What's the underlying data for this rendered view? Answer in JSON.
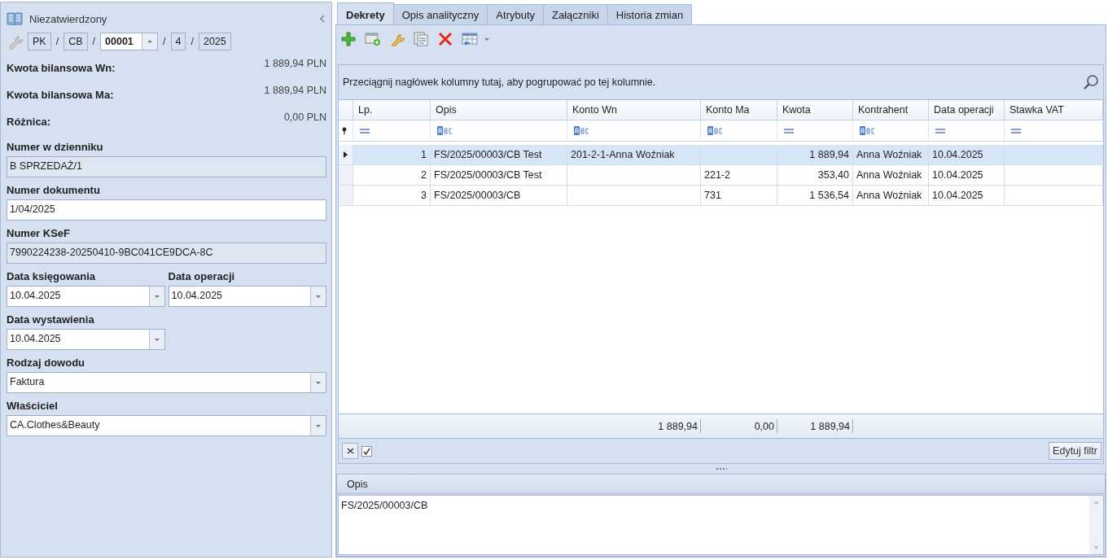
{
  "form": {
    "status": "Niezatwierdzony",
    "number_parts": [
      {
        "kind": "field",
        "text": "PK"
      },
      {
        "kind": "sep",
        "text": "/"
      },
      {
        "kind": "field",
        "text": "CB"
      },
      {
        "kind": "sep",
        "text": "/"
      },
      {
        "kind": "combo",
        "text": "00001"
      },
      {
        "kind": "sep",
        "text": "/"
      },
      {
        "kind": "field",
        "text": "4"
      },
      {
        "kind": "sep",
        "text": "/"
      },
      {
        "kind": "field",
        "text": "2025"
      }
    ],
    "summary": [
      {
        "label": "Kwota bilansowa Wn:",
        "value": "1 889,94 PLN"
      },
      {
        "label": "Kwota bilansowa Ma:",
        "value": "1 889,94 PLN"
      },
      {
        "label": "Różnica:",
        "value": "0,00 PLN"
      }
    ],
    "fields": [
      {
        "kind": "readonly",
        "label": "Numer w dzienniku",
        "value": "B SPRZEDAŻ/1"
      },
      {
        "kind": "text",
        "label": "Numer dokumentu",
        "value": "1/04/2025"
      },
      {
        "kind": "readonly",
        "label": "Numer KSeF",
        "value": "7990224238-20250410-9BC041CE9DCA-8C"
      },
      {
        "kind": "date",
        "label": "Data księgowania",
        "value": "10.04.2025"
      },
      {
        "kind": "date",
        "label": "Data operacji",
        "value": "10.04.2025"
      },
      {
        "kind": "date",
        "label": "Data wystawienia",
        "value": "10.04.2025"
      },
      {
        "kind": "combo",
        "label": "Rodzaj dowodu",
        "value": "Faktura"
      },
      {
        "kind": "combo",
        "label": "Właściciel",
        "value": "CA.Clothes&Beauty"
      }
    ]
  },
  "tabs": [
    {
      "label": "Dekrety",
      "selected": true
    },
    {
      "label": "Opis analityczny",
      "selected": false
    },
    {
      "label": "Atrybuty",
      "selected": false
    },
    {
      "label": "Załączniki",
      "selected": false
    },
    {
      "label": "Historia zmian",
      "selected": false
    }
  ],
  "grid": {
    "group_hint": "Przeciągnij nagłówek kolumny tutaj, aby pogrupować po tej kolumnie.",
    "columns": [
      {
        "label": "Lp.",
        "kind": "number",
        "filter": {
          "kind": "equals"
        }
      },
      {
        "label": "Opis",
        "kind": "text",
        "filter": {
          "kind": "text"
        }
      },
      {
        "label": "Konto Wn",
        "kind": "text",
        "filter": {
          "kind": "text"
        },
        "total": "1 889,94"
      },
      {
        "label": "Konto Ma",
        "kind": "text",
        "filter": {
          "kind": "text"
        },
        "total": "0,00"
      },
      {
        "label": "Kwota",
        "kind": "number",
        "filter": {
          "kind": "equals"
        },
        "total": "1 889,94"
      },
      {
        "label": "Kontrahent",
        "kind": "text",
        "filter": {
          "kind": "text"
        }
      },
      {
        "label": "Data operacji",
        "kind": "text",
        "filter": {
          "kind": "equals"
        }
      },
      {
        "label": "Stawka VAT",
        "kind": "text",
        "filter": {
          "kind": "equals"
        }
      }
    ],
    "rows": [
      {
        "selected": true,
        "cells": [
          "1",
          "FS/2025/00003/CB Test",
          "201-2-1-Anna Woźniak",
          null,
          "1 889,94",
          "Anna Woźniak",
          "10.04.2025",
          null
        ]
      },
      {
        "selected": false,
        "cells": [
          "2",
          "FS/2025/00003/CB Test",
          null,
          "221-2",
          "353,40",
          "Anna Woźniak",
          "10.04.2025",
          null
        ]
      },
      {
        "selected": false,
        "cells": [
          "3",
          "FS/2025/00003/CB",
          null,
          "731",
          "1 536,54",
          "Anna Woźniak",
          "10.04.2025",
          null
        ]
      }
    ],
    "filter_enabled": {
      "checked": true
    },
    "edit_filter": "Edytuj filtr"
  },
  "description": {
    "title": "Opis",
    "text": "FS/2025/00003/CB"
  }
}
